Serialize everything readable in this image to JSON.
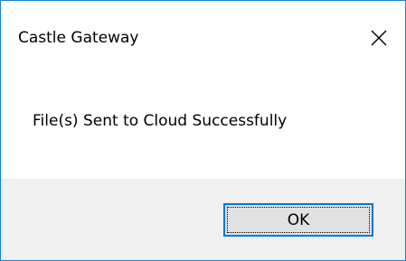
{
  "window": {
    "title": "Castle Gateway",
    "close_icon": "close-icon",
    "accent_color": "#0078d7"
  },
  "message": {
    "text": "File(s) Sent to Cloud Successfully"
  },
  "buttons": {
    "ok_label": "OK"
  }
}
